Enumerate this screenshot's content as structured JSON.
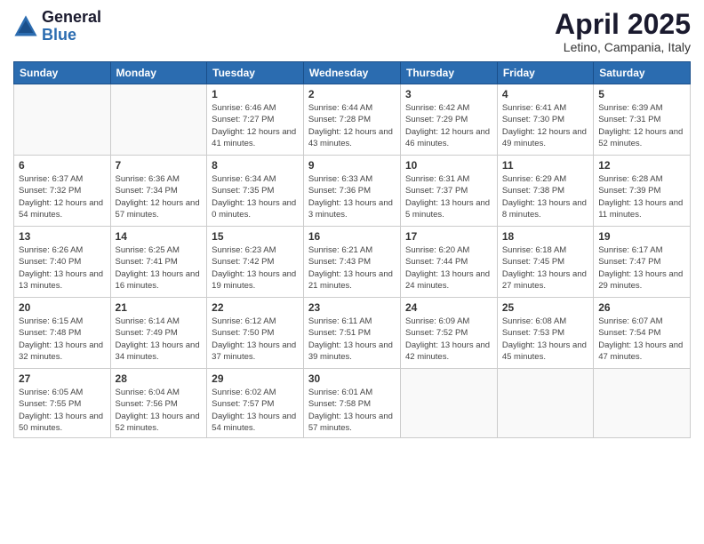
{
  "logo": {
    "general": "General",
    "blue": "Blue"
  },
  "title": "April 2025",
  "location": "Letino, Campania, Italy",
  "days_of_week": [
    "Sunday",
    "Monday",
    "Tuesday",
    "Wednesday",
    "Thursday",
    "Friday",
    "Saturday"
  ],
  "weeks": [
    [
      {
        "day": "",
        "info": ""
      },
      {
        "day": "",
        "info": ""
      },
      {
        "day": "1",
        "info": "Sunrise: 6:46 AM\nSunset: 7:27 PM\nDaylight: 12 hours and 41 minutes."
      },
      {
        "day": "2",
        "info": "Sunrise: 6:44 AM\nSunset: 7:28 PM\nDaylight: 12 hours and 43 minutes."
      },
      {
        "day": "3",
        "info": "Sunrise: 6:42 AM\nSunset: 7:29 PM\nDaylight: 12 hours and 46 minutes."
      },
      {
        "day": "4",
        "info": "Sunrise: 6:41 AM\nSunset: 7:30 PM\nDaylight: 12 hours and 49 minutes."
      },
      {
        "day": "5",
        "info": "Sunrise: 6:39 AM\nSunset: 7:31 PM\nDaylight: 12 hours and 52 minutes."
      }
    ],
    [
      {
        "day": "6",
        "info": "Sunrise: 6:37 AM\nSunset: 7:32 PM\nDaylight: 12 hours and 54 minutes."
      },
      {
        "day": "7",
        "info": "Sunrise: 6:36 AM\nSunset: 7:34 PM\nDaylight: 12 hours and 57 minutes."
      },
      {
        "day": "8",
        "info": "Sunrise: 6:34 AM\nSunset: 7:35 PM\nDaylight: 13 hours and 0 minutes."
      },
      {
        "day": "9",
        "info": "Sunrise: 6:33 AM\nSunset: 7:36 PM\nDaylight: 13 hours and 3 minutes."
      },
      {
        "day": "10",
        "info": "Sunrise: 6:31 AM\nSunset: 7:37 PM\nDaylight: 13 hours and 5 minutes."
      },
      {
        "day": "11",
        "info": "Sunrise: 6:29 AM\nSunset: 7:38 PM\nDaylight: 13 hours and 8 minutes."
      },
      {
        "day": "12",
        "info": "Sunrise: 6:28 AM\nSunset: 7:39 PM\nDaylight: 13 hours and 11 minutes."
      }
    ],
    [
      {
        "day": "13",
        "info": "Sunrise: 6:26 AM\nSunset: 7:40 PM\nDaylight: 13 hours and 13 minutes."
      },
      {
        "day": "14",
        "info": "Sunrise: 6:25 AM\nSunset: 7:41 PM\nDaylight: 13 hours and 16 minutes."
      },
      {
        "day": "15",
        "info": "Sunrise: 6:23 AM\nSunset: 7:42 PM\nDaylight: 13 hours and 19 minutes."
      },
      {
        "day": "16",
        "info": "Sunrise: 6:21 AM\nSunset: 7:43 PM\nDaylight: 13 hours and 21 minutes."
      },
      {
        "day": "17",
        "info": "Sunrise: 6:20 AM\nSunset: 7:44 PM\nDaylight: 13 hours and 24 minutes."
      },
      {
        "day": "18",
        "info": "Sunrise: 6:18 AM\nSunset: 7:45 PM\nDaylight: 13 hours and 27 minutes."
      },
      {
        "day": "19",
        "info": "Sunrise: 6:17 AM\nSunset: 7:47 PM\nDaylight: 13 hours and 29 minutes."
      }
    ],
    [
      {
        "day": "20",
        "info": "Sunrise: 6:15 AM\nSunset: 7:48 PM\nDaylight: 13 hours and 32 minutes."
      },
      {
        "day": "21",
        "info": "Sunrise: 6:14 AM\nSunset: 7:49 PM\nDaylight: 13 hours and 34 minutes."
      },
      {
        "day": "22",
        "info": "Sunrise: 6:12 AM\nSunset: 7:50 PM\nDaylight: 13 hours and 37 minutes."
      },
      {
        "day": "23",
        "info": "Sunrise: 6:11 AM\nSunset: 7:51 PM\nDaylight: 13 hours and 39 minutes."
      },
      {
        "day": "24",
        "info": "Sunrise: 6:09 AM\nSunset: 7:52 PM\nDaylight: 13 hours and 42 minutes."
      },
      {
        "day": "25",
        "info": "Sunrise: 6:08 AM\nSunset: 7:53 PM\nDaylight: 13 hours and 45 minutes."
      },
      {
        "day": "26",
        "info": "Sunrise: 6:07 AM\nSunset: 7:54 PM\nDaylight: 13 hours and 47 minutes."
      }
    ],
    [
      {
        "day": "27",
        "info": "Sunrise: 6:05 AM\nSunset: 7:55 PM\nDaylight: 13 hours and 50 minutes."
      },
      {
        "day": "28",
        "info": "Sunrise: 6:04 AM\nSunset: 7:56 PM\nDaylight: 13 hours and 52 minutes."
      },
      {
        "day": "29",
        "info": "Sunrise: 6:02 AM\nSunset: 7:57 PM\nDaylight: 13 hours and 54 minutes."
      },
      {
        "day": "30",
        "info": "Sunrise: 6:01 AM\nSunset: 7:58 PM\nDaylight: 13 hours and 57 minutes."
      },
      {
        "day": "",
        "info": ""
      },
      {
        "day": "",
        "info": ""
      },
      {
        "day": "",
        "info": ""
      }
    ]
  ]
}
